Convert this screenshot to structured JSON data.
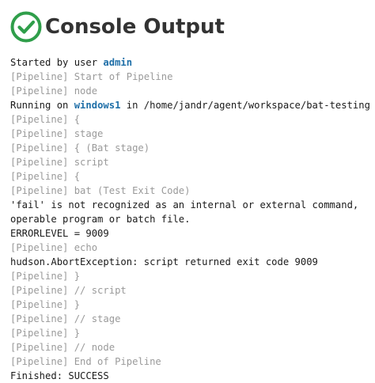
{
  "header": {
    "title": "Console Output",
    "status_icon": "success-check-icon",
    "status_color": "#2f9e4a"
  },
  "console": {
    "lines": [
      {
        "kind": "started",
        "prefix": "Started by user ",
        "user": "admin"
      },
      {
        "kind": "pipeline",
        "text": "[Pipeline] Start of Pipeline"
      },
      {
        "kind": "pipeline",
        "text": "[Pipeline] node"
      },
      {
        "kind": "running",
        "prefix": "Running on ",
        "node": "windows1",
        "suffix": " in /home/jandr/agent/workspace/bat-testing"
      },
      {
        "kind": "pipeline",
        "text": "[Pipeline] {"
      },
      {
        "kind": "pipeline",
        "text": "[Pipeline] stage"
      },
      {
        "kind": "pipeline",
        "text": "[Pipeline] { (Bat stage)"
      },
      {
        "kind": "pipeline",
        "text": "[Pipeline] script"
      },
      {
        "kind": "pipeline",
        "text": "[Pipeline] {"
      },
      {
        "kind": "pipeline",
        "text": "[Pipeline] bat (Test Exit Code)"
      },
      {
        "kind": "output",
        "text": "'fail' is not recognized as an internal or external command,"
      },
      {
        "kind": "output",
        "text": "operable program or batch file."
      },
      {
        "kind": "output",
        "text": "ERRORLEVEL = 9009"
      },
      {
        "kind": "pipeline",
        "text": "[Pipeline] echo"
      },
      {
        "kind": "output",
        "text": "hudson.AbortException: script returned exit code 9009"
      },
      {
        "kind": "pipeline",
        "text": "[Pipeline] }"
      },
      {
        "kind": "pipeline",
        "text": "[Pipeline] // script"
      },
      {
        "kind": "pipeline",
        "text": "[Pipeline] }"
      },
      {
        "kind": "pipeline",
        "text": "[Pipeline] // stage"
      },
      {
        "kind": "pipeline",
        "text": "[Pipeline] }"
      },
      {
        "kind": "pipeline",
        "text": "[Pipeline] // node"
      },
      {
        "kind": "pipeline",
        "text": "[Pipeline] End of Pipeline"
      },
      {
        "kind": "output",
        "text": "Finished: SUCCESS"
      }
    ]
  }
}
